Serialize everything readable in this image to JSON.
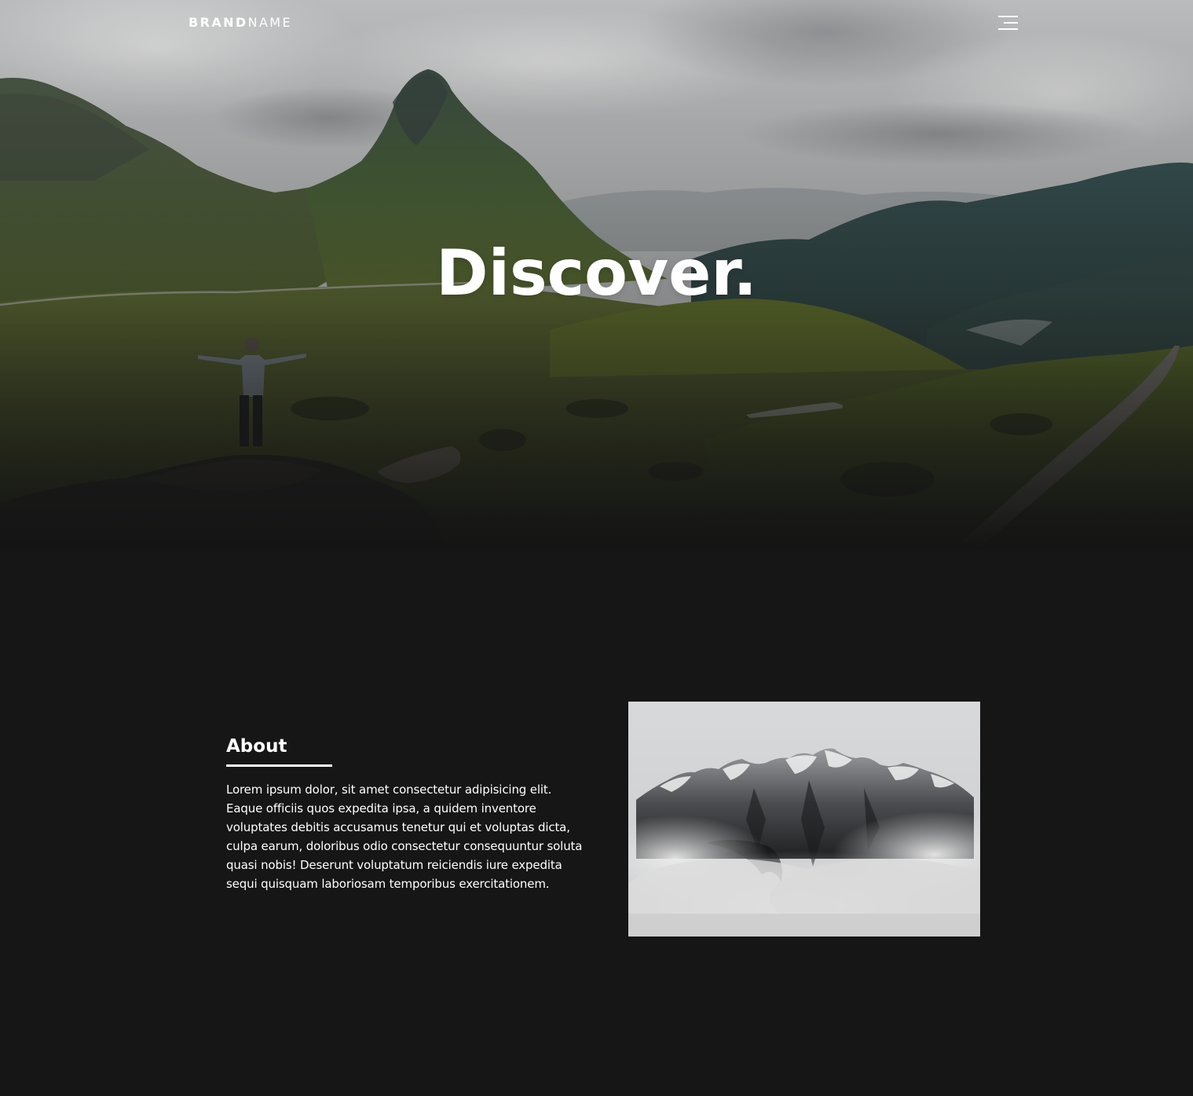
{
  "navbar": {
    "brand_bold": "BRAND",
    "brand_light": "NAME",
    "menu_icon": "hamburger-menu-icon"
  },
  "hero": {
    "title": "Discover.",
    "image": "mountain-valley-person-photo"
  },
  "about": {
    "heading": "About",
    "body": "Lorem ipsum dolor, sit amet consectetur adipisicing elit. Eaque officiis quos expedita ipsa, a quidem inventore voluptates debitis accusamus tenetur qui et voluptas dicta, culpa earum, doloribus odio consectetur consequuntur soluta quasi nobis! Deserunt voluptatum reiciendis iure expedita sequi quisquam laboriosam temporibus exercitationem.",
    "image": "snowy-mountain-clouds-photo"
  },
  "colors": {
    "background": "#161616",
    "text": "#ffffff"
  }
}
